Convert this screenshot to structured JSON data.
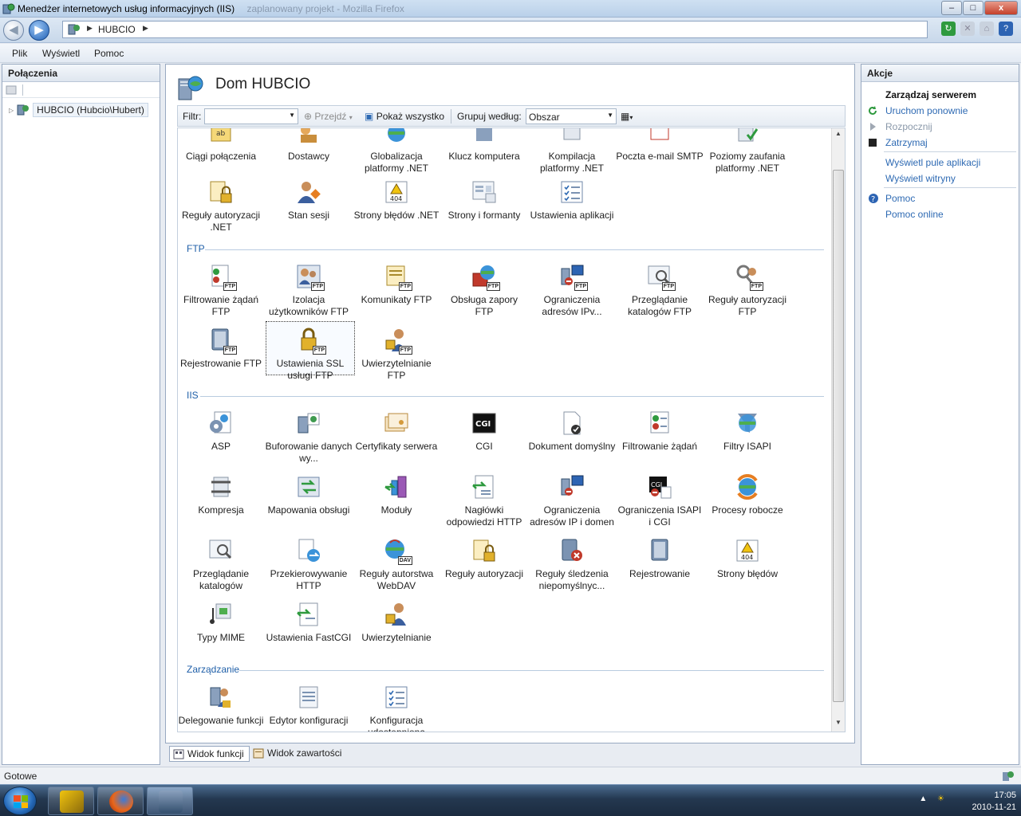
{
  "window": {
    "title": "Menedżer internetowych usług informacyjnych (IIS)",
    "title_ghost": "zaplanowany projekt - Mozilla Firefox",
    "min": "–",
    "max": "□",
    "close": "x"
  },
  "address": {
    "crumb": "HUBCIO"
  },
  "menu": {
    "file": "Plik",
    "view": "Wyświetl",
    "help": "Pomoc"
  },
  "connections": {
    "title": "Połączenia",
    "tree_node": "HUBCIO (Hubcio\\Hubert)"
  },
  "center": {
    "title": "Dom HUBCIO",
    "filter_label": "Filtr:",
    "go_label": "Przejdź",
    "show_all_label": "Pokaż wszystko",
    "group_by_label": "Grupuj według:",
    "group_by_value": "Obszar"
  },
  "sections": {
    "ftp": "FTP",
    "iis": "IIS",
    "mgmt": "Zarządzanie"
  },
  "features": {
    "aspnet_row1": [
      "Ciągi połączenia",
      "Dostawcy",
      "Globalizacja platformy .NET",
      "Klucz komputera",
      "Kompilacja platformy .NET",
      "Poczta e-mail SMTP",
      "Poziomy zaufania platformy .NET"
    ],
    "aspnet_row2": [
      "Reguły autoryzacji .NET",
      "Stan sesji",
      "Strony błędów .NET",
      "Strony i formanty",
      "Ustawienia aplikacji"
    ],
    "ftp_row1": [
      "Filtrowanie żądań FTP",
      "Izolacja użytkowników FTP",
      "Komunikaty FTP",
      "Obsługa zapory FTP",
      "Ograniczenia adresów IPv...",
      "Przeglądanie katalogów FTP",
      "Reguły autoryzacji FTP"
    ],
    "ftp_row2": [
      "Rejestrowanie FTP",
      "Ustawienia SSL usługi FTP",
      "Uwierzytelnianie FTP"
    ],
    "iis_row1": [
      "ASP",
      "Buforowanie danych wy...",
      "Certyfikaty serwera",
      "CGI",
      "Dokument domyślny",
      "Filtrowanie żądań",
      "Filtry ISAPI"
    ],
    "iis_row2": [
      "Kompresja",
      "Mapowania obsługi",
      "Moduły",
      "Nagłówki odpowiedzi HTTP",
      "Ograniczenia adresów IP i domen",
      "Ograniczenia ISAPI i CGI",
      "Procesy robocze"
    ],
    "iis_row3": [
      "Przeglądanie katalogów",
      "Przekierowywanie HTTP",
      "Reguły autorstwa WebDAV",
      "Reguły autoryzacji",
      "Reguły śledzenia niepomyślnyc...",
      "Rejestrowanie",
      "Strony błędów"
    ],
    "iis_row4": [
      "Typy MIME",
      "Ustawienia FastCGI",
      "Uwierzytelnianie"
    ],
    "mgmt_row1": [
      "Delegowanie funkcji",
      "Edytor konfiguracji",
      "Konfiguracja udostępniona"
    ],
    "badges": {
      "ftp": "FTP",
      "cgi": "CGI",
      "e404": "404",
      "dav": "DAV"
    }
  },
  "bottom_tabs": {
    "features_view": "Widok funkcji",
    "content_view": "Widok zawartości"
  },
  "actions": {
    "title": "Akcje",
    "manage_server": "Zarządzaj serwerem",
    "restart": "Uruchom ponownie",
    "start": "Rozpocznij",
    "stop": "Zatrzymaj",
    "view_pools": "Wyświetl pule aplikacji",
    "view_sites": "Wyświetl witryny",
    "help": "Pomoc",
    "help_online": "Pomoc online"
  },
  "status": {
    "text": "Gotowe"
  },
  "tray": {
    "time": "17:05",
    "date": "2010-11-21"
  },
  "colors": {
    "link": "#2e6ab3",
    "section": "#1f5fa8",
    "taskbar": "#243850"
  }
}
